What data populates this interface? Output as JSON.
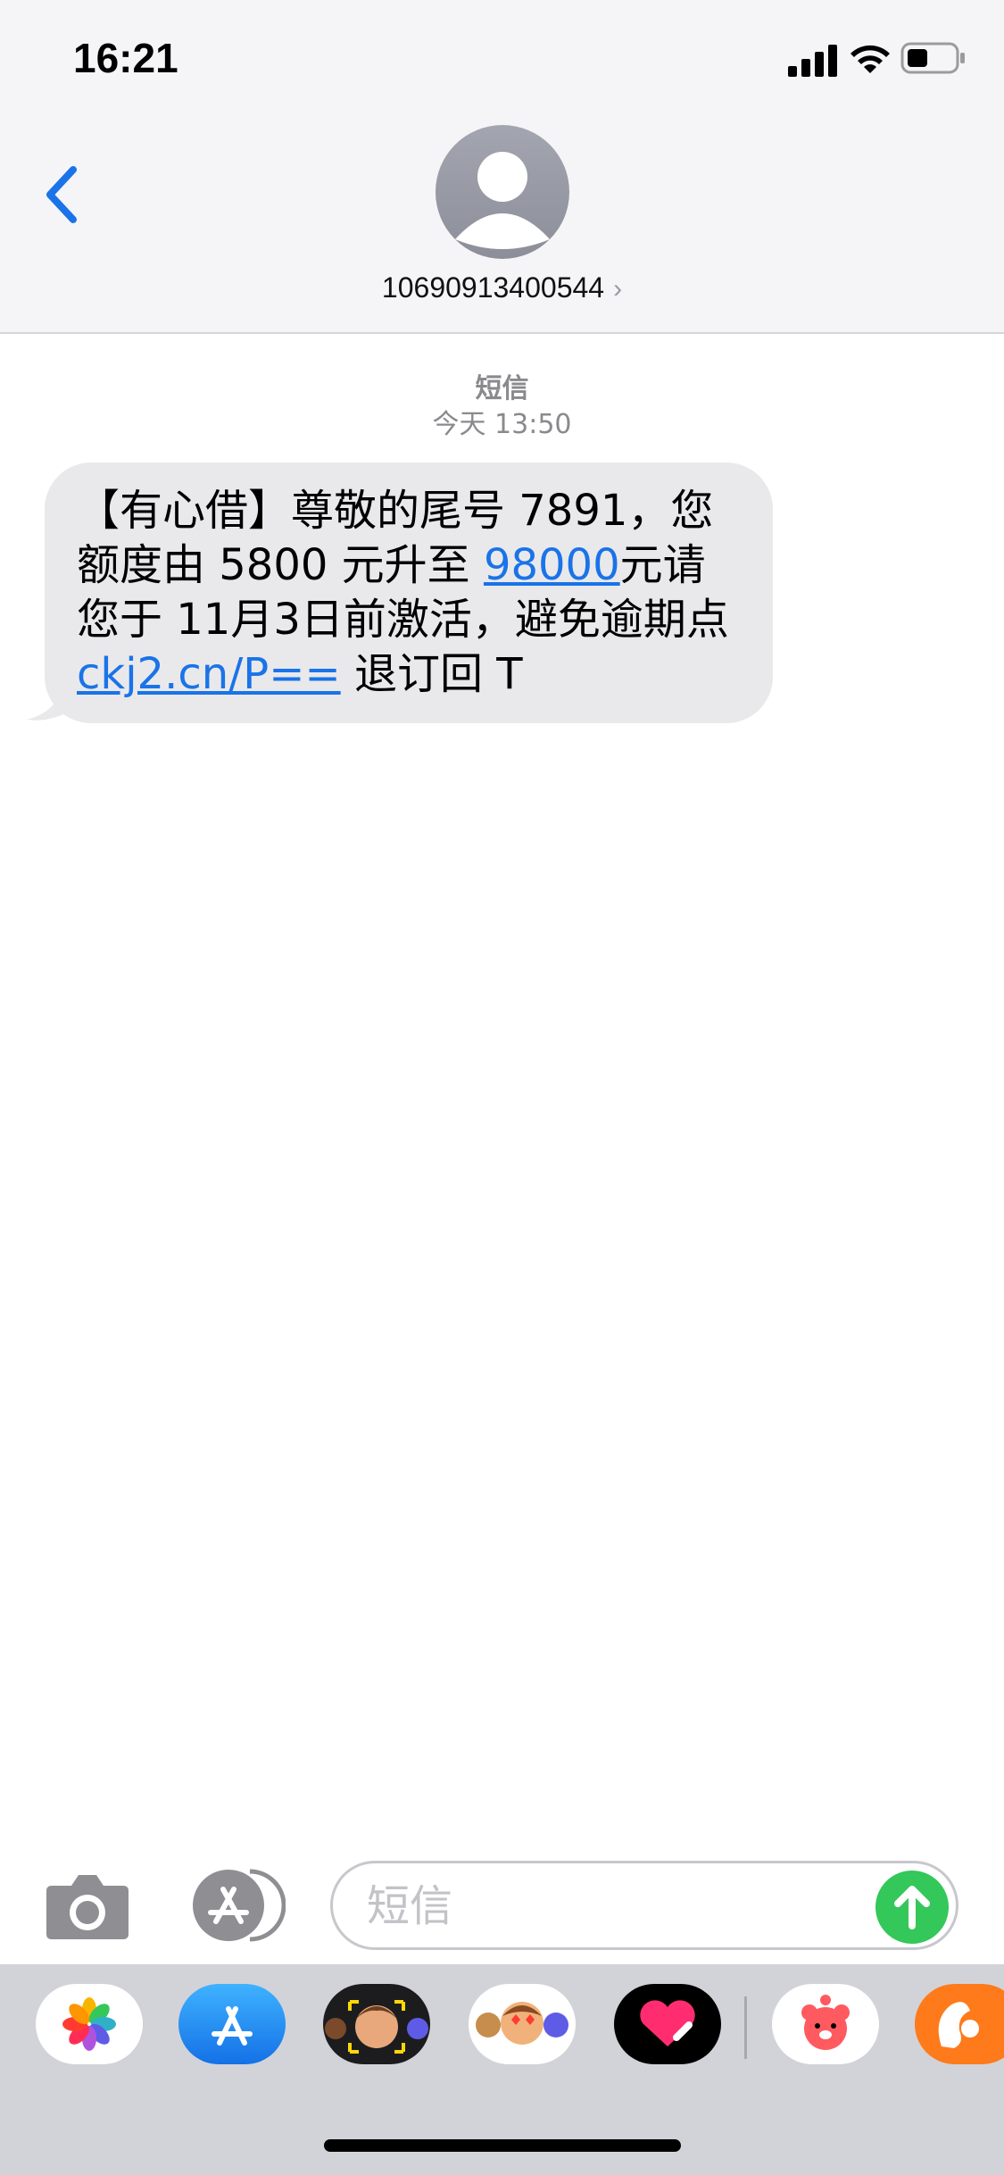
{
  "status_bar": {
    "time": "16:21",
    "icons": [
      "cellular-signal-icon",
      "wifi-icon",
      "battery-icon"
    ]
  },
  "header": {
    "back_icon": "chevron-left-icon",
    "avatar_icon": "person-icon",
    "contact": "10690913400544",
    "contact_chevron": "›"
  },
  "thread": {
    "service_label": "短信",
    "timestamp": "今天 13:50",
    "message": {
      "part1": "【有心借】尊敬的尾号 7891，您额度由 5800 元升至 ",
      "link_amount": "98000",
      "part2": "元请您于 11月3日前激活，避免逾期点 ",
      "link_url": "ckj2.cn/P==",
      "part3": " 退订回 T"
    }
  },
  "composer": {
    "camera_icon": "camera-icon",
    "apps_icon": "app-store-icon",
    "placeholder": "短信",
    "send_icon": "arrow-up-icon"
  },
  "drawer": {
    "apps": [
      "photos-app-icon",
      "app-store-app-icon",
      "memoji-app-icon",
      "animoji-stickers-app-icon",
      "heart-digital-touch-app-icon",
      "red-bear-app-icon",
      "orange-squirrel-app-icon"
    ]
  },
  "colors": {
    "accent": "#1a73e8",
    "send_green": "#34c759",
    "bubble_gray": "#e9e9eb"
  }
}
